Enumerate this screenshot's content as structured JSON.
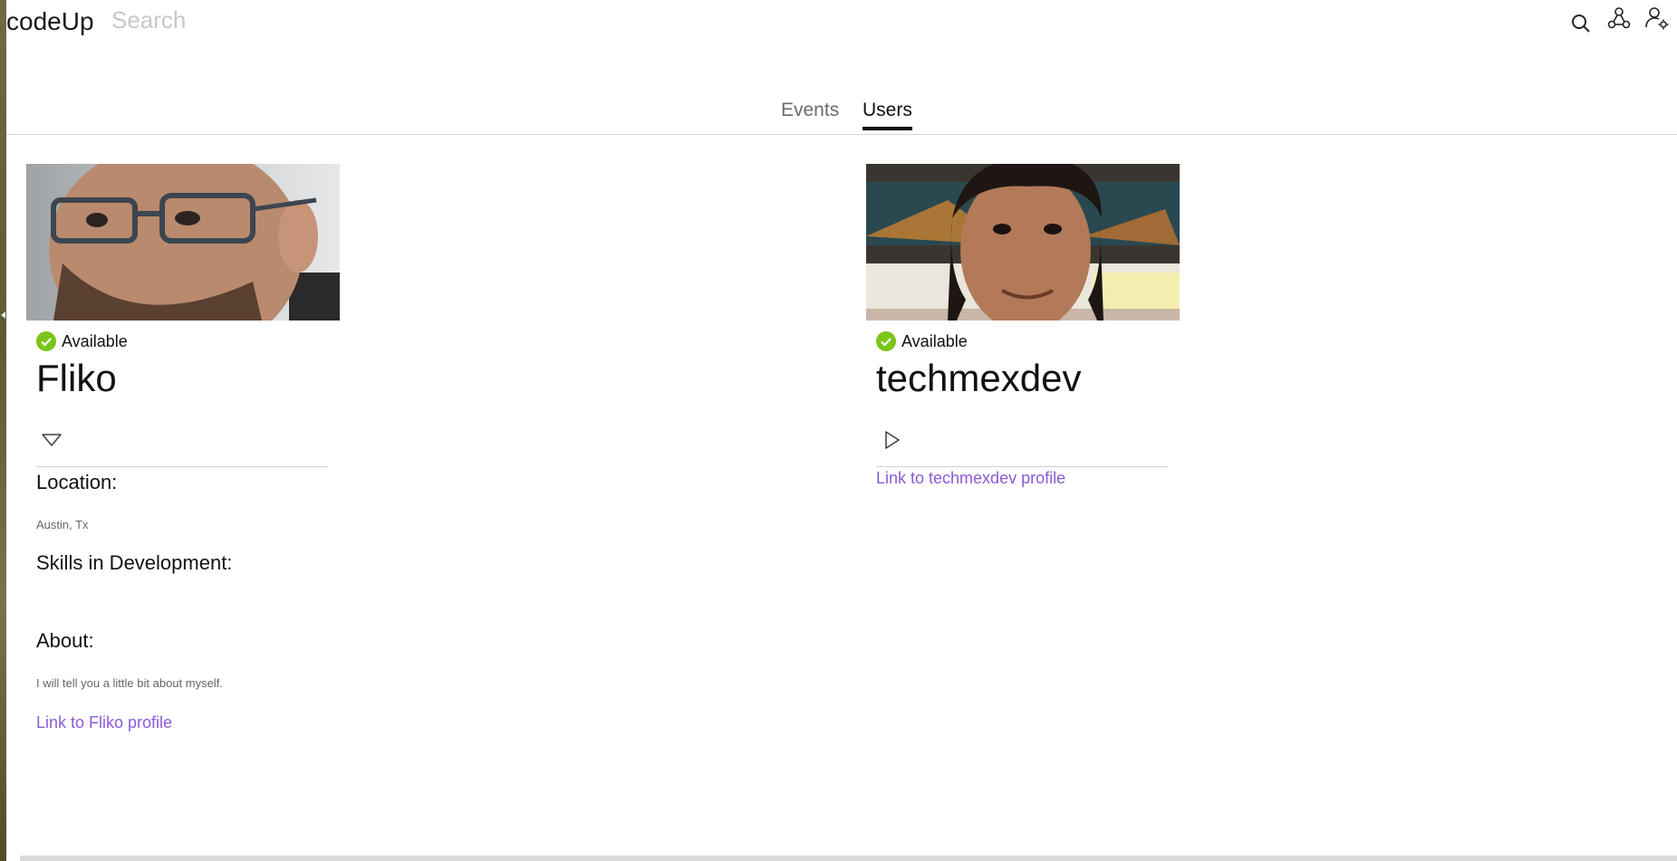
{
  "header": {
    "brand": "codeUp",
    "search_placeholder": "Search",
    "icons": [
      "search-icon",
      "network-icon",
      "user-settings-icon"
    ]
  },
  "tabs": [
    {
      "label": "Events",
      "active": false
    },
    {
      "label": "Users",
      "active": true
    }
  ],
  "users": [
    {
      "status": "Available",
      "name": "Fliko",
      "expanded": true,
      "location_label": "Location:",
      "location": "Austin, Tx",
      "skills_label": "Skills in Development:",
      "about_label": "About:",
      "about": "I will tell you a little bit about myself.",
      "link": "Link to Fliko profile"
    },
    {
      "status": "Available",
      "name": "techmexdev",
      "expanded": false,
      "link": "Link to techmexdev profile"
    }
  ],
  "colors": {
    "accent_link": "#8a5ad6",
    "status_green": "#7cc41a",
    "tab_active": "#111111"
  }
}
